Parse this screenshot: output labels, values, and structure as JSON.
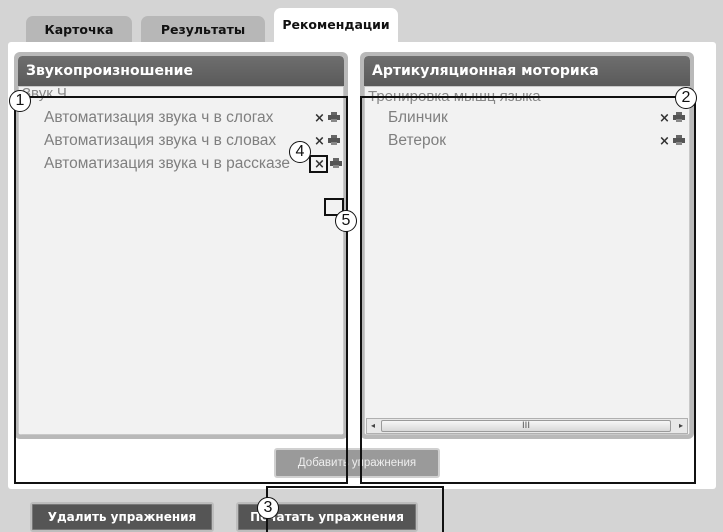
{
  "tabs": [
    {
      "label": "Карточка",
      "active": false
    },
    {
      "label": "Результаты",
      "active": false
    },
    {
      "label": "Рекомендации",
      "active": true
    }
  ],
  "panels": {
    "left": {
      "title": "Звукопроизношение",
      "group": "Звук Ч",
      "items": [
        "Автоматизация звука ч в слогах",
        "Автоматизация звука ч в словах",
        "Автоматизация звука ч в рассказе"
      ]
    },
    "right": {
      "title": "Артикуляционная моторика",
      "group": "Тренировка мышц языка",
      "items": [
        "Блинчик",
        "Ветерок"
      ]
    }
  },
  "icons": {
    "remove": "close-x-icon",
    "remove_glyph": "×",
    "print": "printer-icon"
  },
  "scrollbar": {
    "left_arrow": "◂",
    "right_arrow": "▸",
    "grip": "III"
  },
  "buttons": {
    "add_exercises": "Добавить упражнения",
    "delete_exercises": "Удалить упражнения",
    "print_exercises": "Печатать упражнения"
  },
  "callouts": [
    "1",
    "2",
    "3",
    "4",
    "5"
  ],
  "colors": {
    "panel_header": "#5f5f5f",
    "background": "#d4d4d4",
    "button_dark": "#555555"
  }
}
